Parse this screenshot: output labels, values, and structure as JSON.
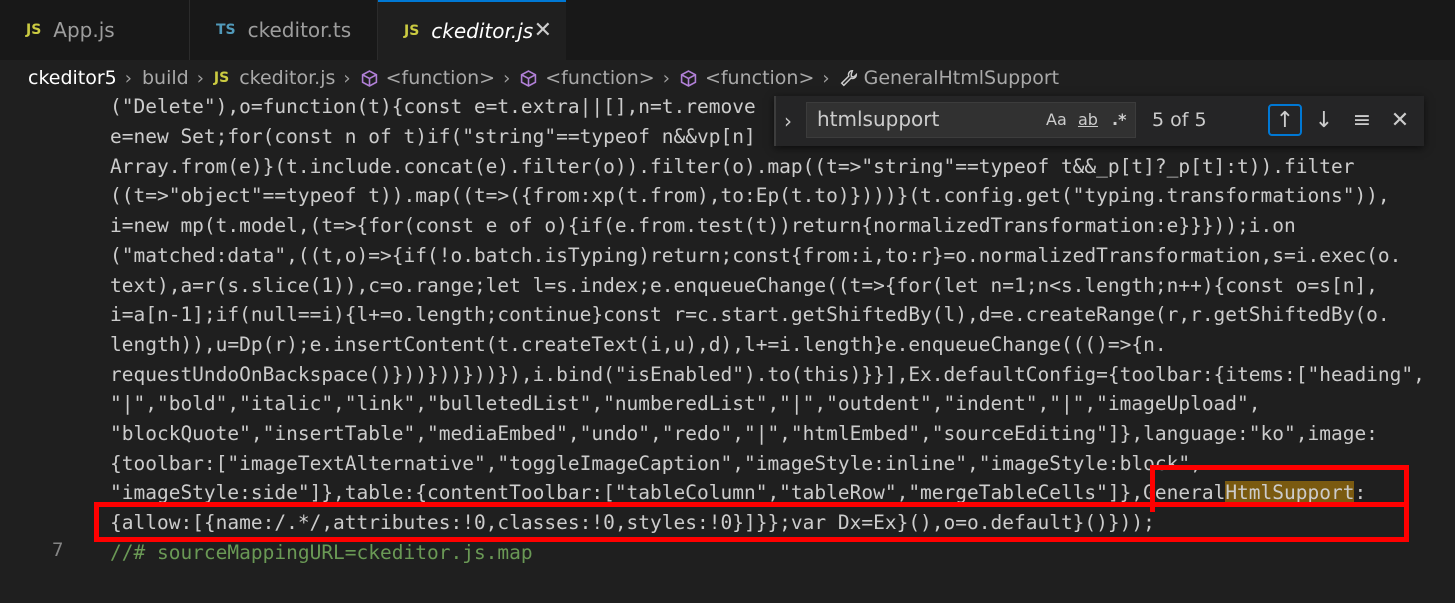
{
  "tabs": [
    {
      "icon": "JS",
      "label": "App.js"
    },
    {
      "icon": "TS",
      "label": "ckeditor.ts"
    },
    {
      "icon": "JS",
      "label": "ckeditor.js",
      "close": "✕"
    }
  ],
  "breadcrumb": {
    "items": [
      "ckeditor5",
      "build",
      "ckeditor.js",
      "<function>",
      "<function>",
      "<function>",
      "GeneralHtmlSupport"
    ],
    "file_icon": "JS"
  },
  "find": {
    "query": "htmlsupport",
    "match_case": "Aa",
    "whole_word": "ab",
    "regex": ".*",
    "count": "5 of 5"
  },
  "code": {
    "lines": [
      "(\"Delete\"),o=function(t){const e=t.extra||[],n=t.remove",
      "e=new Set;for(const n of t)if(\"string\"==typeof n&&vp[n]",
      "Array.from(e)}(t.include.concat(e).filter(o)).filter(o).map((t=>\"string\"==typeof t&&_p[t]?_p[t]:t)).filter",
      "((t=>\"object\"==typeof t)).map((t=>({from:xp(t.from),to:Ep(t.to)})))}(t.config.get(\"typing.transformations\")),",
      "i=new mp(t.model,(t=>{for(const e of o){if(e.from.test(t))return{normalizedTransformation:e}}}));i.on",
      "(\"matched:data\",((t,o)=>{if(!o.batch.isTyping)return;const{from:i,to:r}=o.normalizedTransformation,s=i.exec(o.",
      "text),a=r(s.slice(1)),c=o.range;let l=s.index;e.enqueueChange((t=>{for(let n=1;n<s.length;n++){const o=s[n],",
      "i=a[n-1];if(null==i){l+=o.length;continue}const r=c.start.getShiftedBy(l),d=e.createRange(r,r.getShiftedBy(o.",
      "length)),u=Dp(r);e.insertContent(t.createText(i,u),d),l+=i.length}e.enqueueChange((()=>{n.",
      "requestUndoOnBackspace()}))}))}))}),i.bind(\"isEnabled\").to(this)}}],Ex.defaultConfig={toolbar:{items:[\"heading\",",
      "\"|\",\"bold\",\"italic\",\"link\",\"bulletedList\",\"numberedList\",\"|\",\"outdent\",\"indent\",\"|\",\"imageUpload\",",
      "\"blockQuote\",\"insertTable\",\"mediaEmbed\",\"undo\",\"redo\",\"|\",\"htmlEmbed\",\"sourceEditing\"]},language:\"ko\",image:",
      "{toolbar:[\"imageTextAlternative\",\"toggleImageCaption\",\"imageStyle:inline\",\"imageStyle:block\",",
      "\"imageStyle:side\"]},table:{contentToolbar:[\"tableColumn\",\"tableRow\",\"mergeTableCells\"]},",
      "{allow:[{name:/.*/,attributes:!0,classes:!0,styles:!0}]}};var Dx=Ex}(),o=o.default}()}));"
    ],
    "line14_tail_pre": "General",
    "line14_tail_match": "HtmlSupport",
    "line14_tail_post": ":",
    "line_number": "7",
    "comment_line": "//# sourceMappingURL=ckeditor.js.map"
  },
  "colors": {
    "background": "#1f1f1f",
    "annotation_red": "#ff0000",
    "match_highlight": "#7a5a10",
    "accent": "#0078d4"
  }
}
